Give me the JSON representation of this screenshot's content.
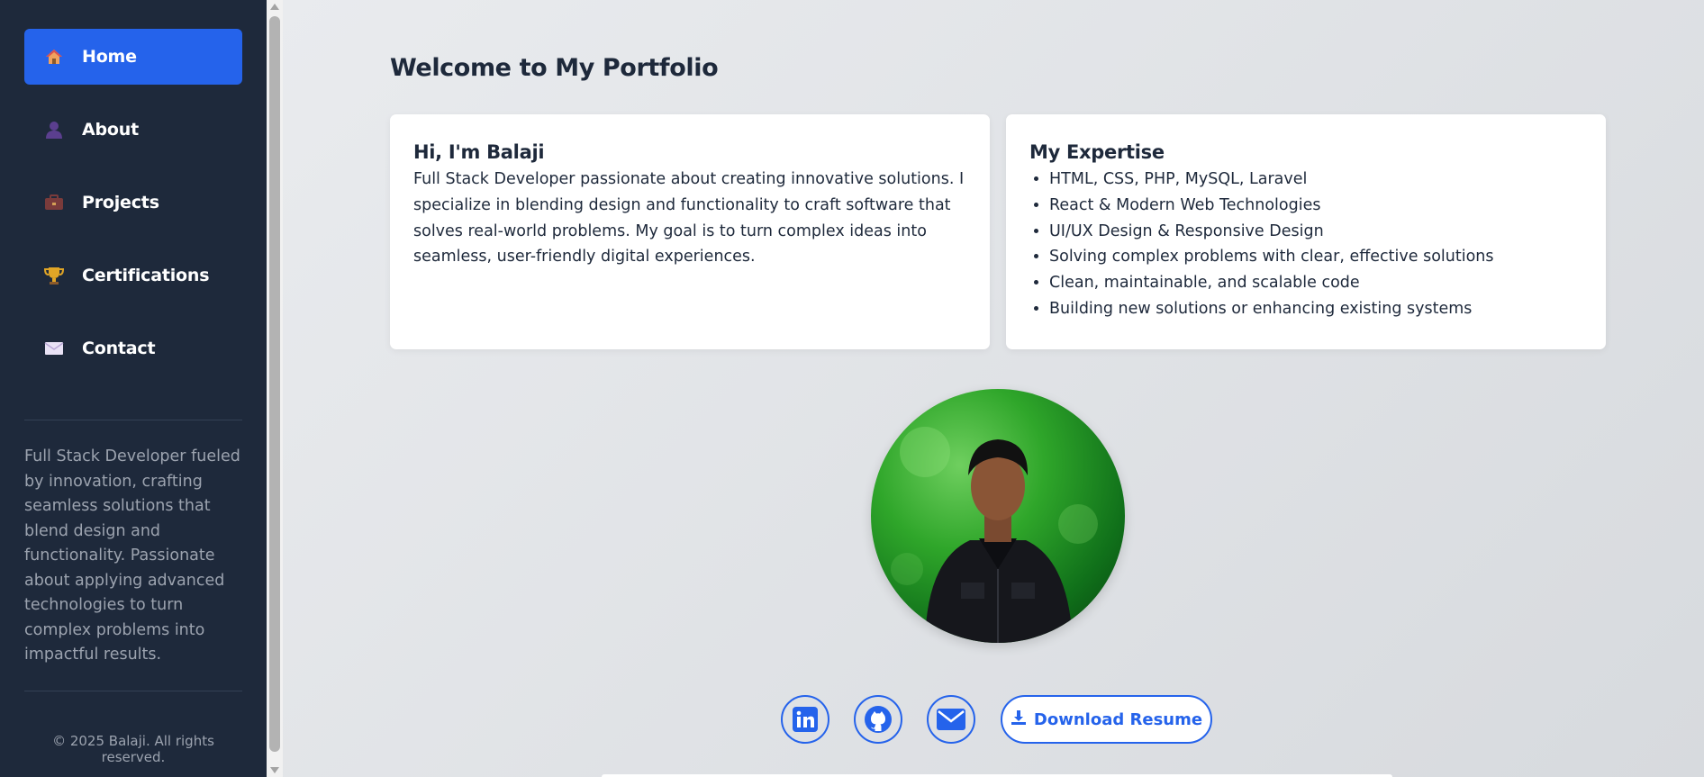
{
  "sidebar": {
    "nav": [
      {
        "label": "Home",
        "icon": "house-icon",
        "active": true
      },
      {
        "label": "About",
        "icon": "person-icon",
        "active": false
      },
      {
        "label": "Projects",
        "icon": "briefcase-icon",
        "active": false
      },
      {
        "label": "Certifications",
        "icon": "trophy-icon",
        "active": false
      },
      {
        "label": "Contact",
        "icon": "envelope-icon",
        "active": false
      }
    ],
    "bio": "Full Stack Developer fueled by innovation, crafting seamless solutions that blend design and functionality. Passionate about applying advanced technologies to turn complex problems into impactful results.",
    "footer": "© 2025 Balaji. All rights reserved."
  },
  "main": {
    "heading": "Welcome to My Portfolio",
    "intro_card": {
      "title": "Hi, I'm Balaji",
      "text": "Full Stack Developer passionate about creating innovative solutions. I specialize in blending design and functionality to craft software that solves real-world problems. My goal is to turn complex ideas into seamless, user-friendly digital experiences."
    },
    "expertise_card": {
      "title": "My Expertise",
      "items": [
        "HTML, CSS, PHP, MySQL, Laravel",
        "React & Modern Web Technologies",
        "UI/UX Design & Responsive Design",
        "Solving complex problems with clear, effective solutions",
        "Clean, maintainable, and scalable code",
        "Building new solutions or enhancing existing systems"
      ]
    },
    "social": [
      {
        "icon": "linkedin-icon"
      },
      {
        "icon": "github-icon"
      },
      {
        "icon": "email-icon"
      }
    ],
    "resume_label": "Download Resume"
  },
  "colors": {
    "sidebar_bg": "#1e293b",
    "accent": "#2563eb",
    "text_dark": "#1e293b",
    "text_muted": "#9ca3af"
  }
}
